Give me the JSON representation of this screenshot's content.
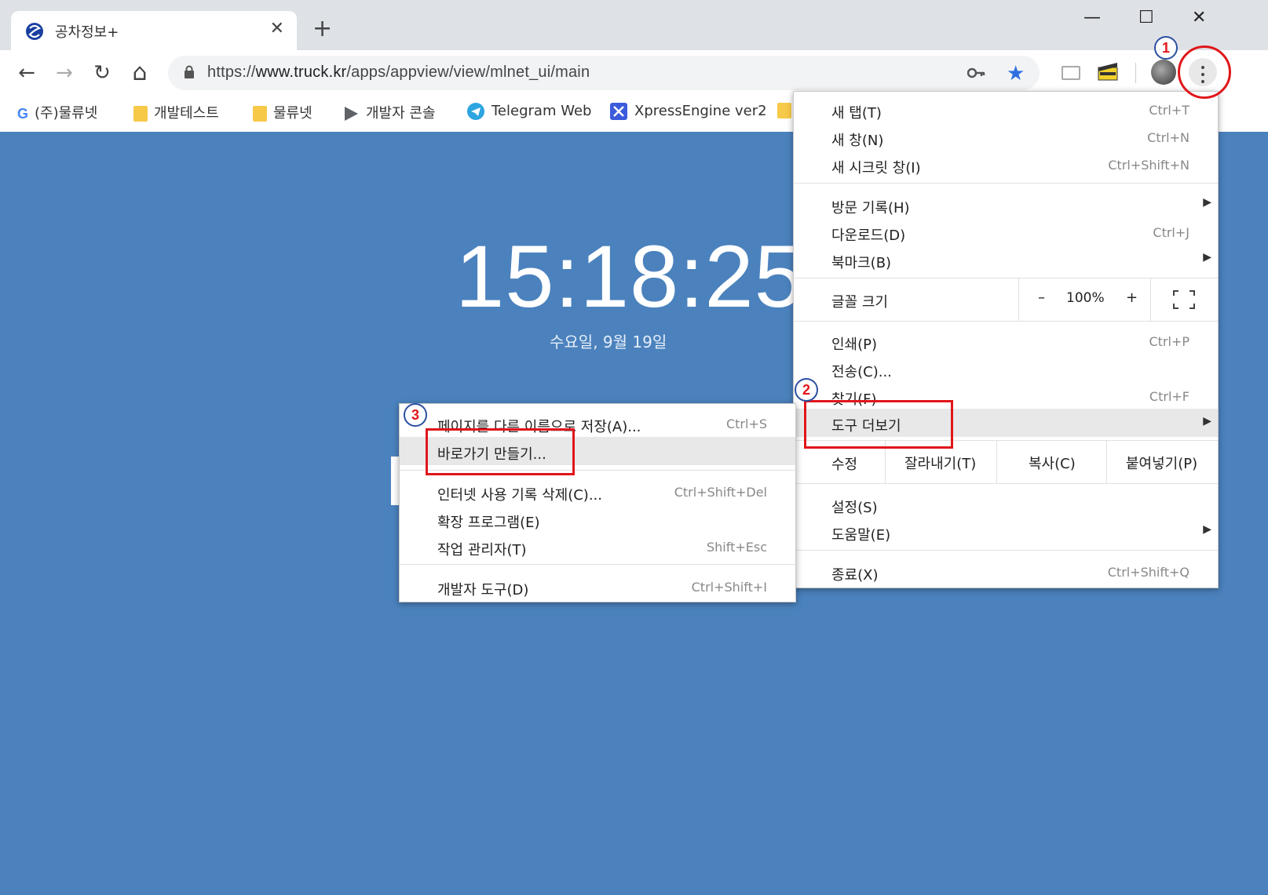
{
  "tab": {
    "title": "공차정보+",
    "close": "✕"
  },
  "new_tab": "+",
  "window": {
    "minimize": "—",
    "maximize": "☐",
    "close": "✕"
  },
  "toolbar": {
    "back": "←",
    "forward": "→",
    "reload": "↻",
    "home": "⌂",
    "url_scheme": "https://",
    "url_host": "www.truck.kr",
    "url_path": "/apps/appview/view/mlnet_ui/main",
    "star": "★"
  },
  "bookmarks": [
    {
      "label": "(주)물류넷",
      "icon": "google-icon"
    },
    {
      "label": "개발테스트",
      "icon": "folder-icon"
    },
    {
      "label": "물류넷",
      "icon": "folder-icon"
    },
    {
      "label": "개발자 콘솔",
      "icon": "play-icon"
    },
    {
      "label": "Telegram Web",
      "icon": "telegram-icon"
    },
    {
      "label": "XpressEngine ver2",
      "icon": "xe-icon"
    }
  ],
  "content": {
    "clock": "15:18:25",
    "date": "수요일, 9월 19일"
  },
  "menu": {
    "new_tab": {
      "label": "새 탭(T)",
      "shortcut": "Ctrl+T"
    },
    "new_window": {
      "label": "새 창(N)",
      "shortcut": "Ctrl+N"
    },
    "incognito": {
      "label": "새 시크릿 창(I)",
      "shortcut": "Ctrl+Shift+N"
    },
    "history": {
      "label": "방문 기록(H)"
    },
    "downloads": {
      "label": "다운로드(D)",
      "shortcut": "Ctrl+J"
    },
    "bookmarks": {
      "label": "북마크(B)"
    },
    "zoom": {
      "label": "글꼴 크기",
      "minus": "–",
      "value": "100%",
      "plus": "+"
    },
    "print": {
      "label": "인쇄(P)",
      "shortcut": "Ctrl+P"
    },
    "cast": {
      "label": "전송(C)..."
    },
    "find": {
      "label": "찾기(F)",
      "shortcut": "Ctrl+F"
    },
    "more_tools": {
      "label": "도구 더보기"
    },
    "edit": {
      "label": "수정",
      "cut": "잘라내기(T)",
      "copy": "복사(C)",
      "paste": "붙여넣기(P)"
    },
    "settings": {
      "label": "설정(S)"
    },
    "help": {
      "label": "도움말(E)"
    },
    "exit": {
      "label": "종료(X)",
      "shortcut": "Ctrl+Shift+Q"
    },
    "arrow": "▶"
  },
  "submenu": {
    "save_as": {
      "label": "페이지를 다른 이름으로 저장(A)...",
      "shortcut": "Ctrl+S"
    },
    "create_shortcut": {
      "label": "바로가기 만들기..."
    },
    "clear_data": {
      "label": "인터넷 사용 기록 삭제(C)...",
      "shortcut": "Ctrl+Shift+Del"
    },
    "extensions": {
      "label": "확장 프로그램(E)"
    },
    "task_manager": {
      "label": "작업 관리자(T)",
      "shortcut": "Shift+Esc"
    },
    "devtools": {
      "label": "개발자 도구(D)",
      "shortcut": "Ctrl+Shift+I"
    }
  },
  "annotations": {
    "step1": "1",
    "step2": "2",
    "step3": "3",
    "color": "#e0161b"
  }
}
